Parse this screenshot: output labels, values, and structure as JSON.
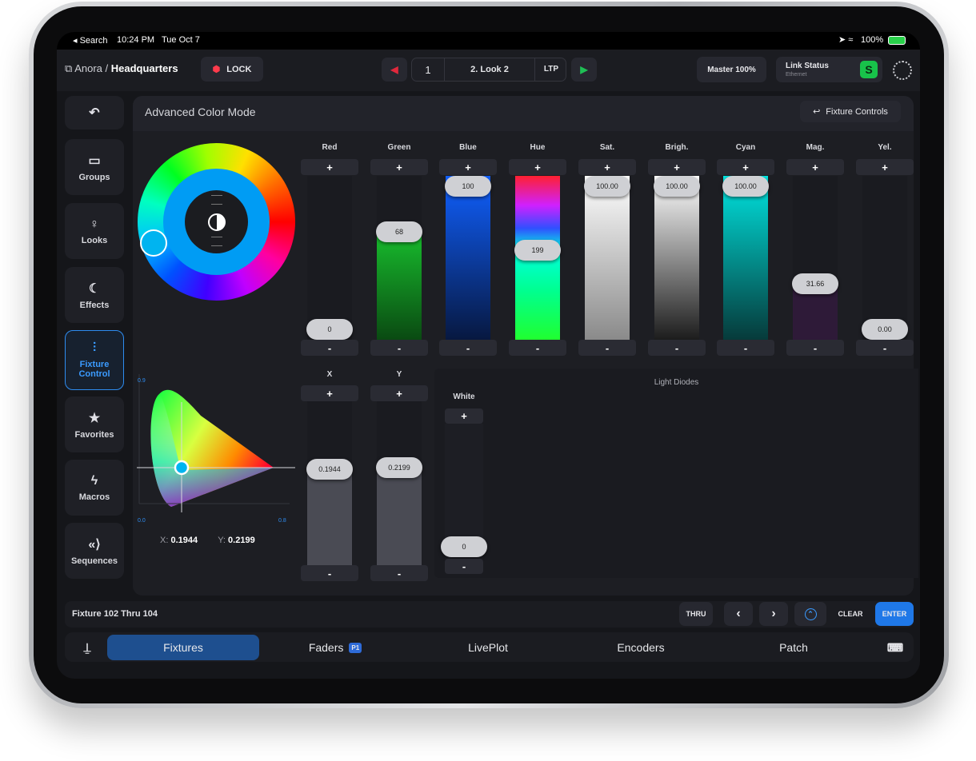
{
  "status_bar": {
    "back": "◂ Search",
    "time": "10:24 PM",
    "date": "Tue Oct 7",
    "battery": "100%"
  },
  "header": {
    "breadcrumb_parent": "Anora",
    "breadcrumb_sep": " / ",
    "breadcrumb_current": "Headquarters",
    "lock_label": "LOCK",
    "cue_number": "1",
    "cue_name": "2. Look 2",
    "mode": "LTP",
    "master": "Master 100%",
    "link_status_title": "Link Status",
    "link_status_sub": "Ethernet",
    "link_badge": "S"
  },
  "sidebar": {
    "back": "↶",
    "items": [
      {
        "label": "Groups",
        "icon": "folder-icon",
        "glyph": "▭"
      },
      {
        "label": "Looks",
        "icon": "bulb-icon",
        "glyph": "♀"
      },
      {
        "label": "Effects",
        "icon": "moon-sparkle-icon",
        "glyph": "☾"
      },
      {
        "label": "Fixture Control",
        "icon": "sliders-icon",
        "glyph": "⫶"
      },
      {
        "label": "Favorites",
        "icon": "star-icon",
        "glyph": "★"
      },
      {
        "label": "Macros",
        "icon": "bolt-icon",
        "glyph": "ϟ"
      },
      {
        "label": "Sequences",
        "icon": "sequence-icon",
        "glyph": "«⟩"
      }
    ]
  },
  "panel": {
    "title": "Advanced Color Mode",
    "fixture_controls": "Fixture Controls"
  },
  "plus": "+",
  "minus": "-",
  "faders": [
    {
      "name": "Red",
      "value": "0",
      "level": 0.0
    },
    {
      "name": "Green",
      "value": "68",
      "level": 0.68
    },
    {
      "name": "Blue",
      "value": "100",
      "level": 1.0
    },
    {
      "name": "Hue",
      "value": "199",
      "level": 0.553
    },
    {
      "name": "Sat.",
      "value": "100.00",
      "level": 1.0
    },
    {
      "name": "Brigh.",
      "value": "100.00",
      "level": 1.0
    },
    {
      "name": "Cyan",
      "value": "100.00",
      "level": 1.0
    },
    {
      "name": "Mag.",
      "value": "31.66",
      "level": 0.3166
    },
    {
      "name": "Yel.",
      "value": "0.00",
      "level": 0.0
    }
  ],
  "cie": {
    "x_label": "X:",
    "x_value": "0.1944",
    "y_label": "Y:",
    "y_value": "0.2199",
    "axis_y_max": "0.9",
    "axis_x_min": "0.0",
    "axis_x_max": "0.8"
  },
  "xy_faders": [
    {
      "name": "X",
      "value": "0.1944",
      "level": 0.1944
    },
    {
      "name": "Y",
      "value": "0.2199",
      "level": 0.2199
    }
  ],
  "light_diodes": {
    "title": "Light Diodes",
    "white_label": "White",
    "white_value": "0"
  },
  "command_line": {
    "text": "Fixture 102 Thru 104",
    "thru": "THRU",
    "prev": "‹",
    "next": "›",
    "clear": "CLEAR",
    "enter": "ENTER"
  },
  "bottom_tabs": [
    {
      "label": "Fixtures",
      "active": true
    },
    {
      "label": "Faders",
      "badge": "P1"
    },
    {
      "label": "LivePlot"
    },
    {
      "label": "Encoders"
    },
    {
      "label": "Patch"
    }
  ],
  "colors": {
    "accent": "#2e8cf0",
    "active_tab": "#1e4f8f",
    "link_ok": "#18c24a",
    "cue_red": "#e0283c",
    "cue_green": "#1fbf55"
  }
}
